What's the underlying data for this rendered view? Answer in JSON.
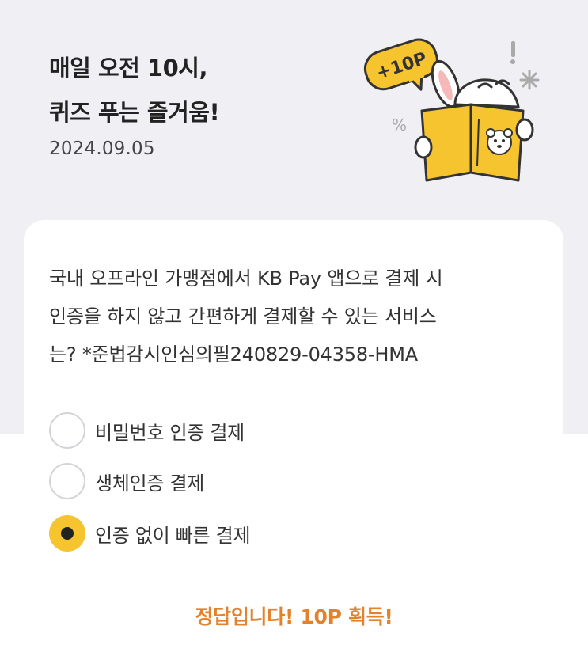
{
  "header": {
    "title_line1": "매일 오전 10시,",
    "title_line2": "퀴즈 푸는 즐거움!",
    "date": "2024.09.05",
    "badge": "+10P"
  },
  "quiz": {
    "question_lines": [
      "국내 오프라인 가맹점에서 KB Pay 앱으로 결제 시",
      "인증을 하지 않고 간편하게 결제할 수 있는 서비스",
      "는? *준법감시인심의필240829-04358-HMA"
    ],
    "options": [
      {
        "label": "비밀번호 인증 결제",
        "selected": false
      },
      {
        "label": "생체인증 결제",
        "selected": false
      },
      {
        "label": "인증 없이 빠른 결제",
        "selected": true
      }
    ],
    "result": "정답입니다! 10P 획득!"
  },
  "colors": {
    "background": "#f0f0f4",
    "accent_yellow": "#f6c42f",
    "result_orange": "#e4822c"
  },
  "icons": {
    "illustration": "rabbit-reading-book-icon",
    "radio_selected": "radio-selected-icon",
    "radio_empty": "radio-empty-icon"
  }
}
